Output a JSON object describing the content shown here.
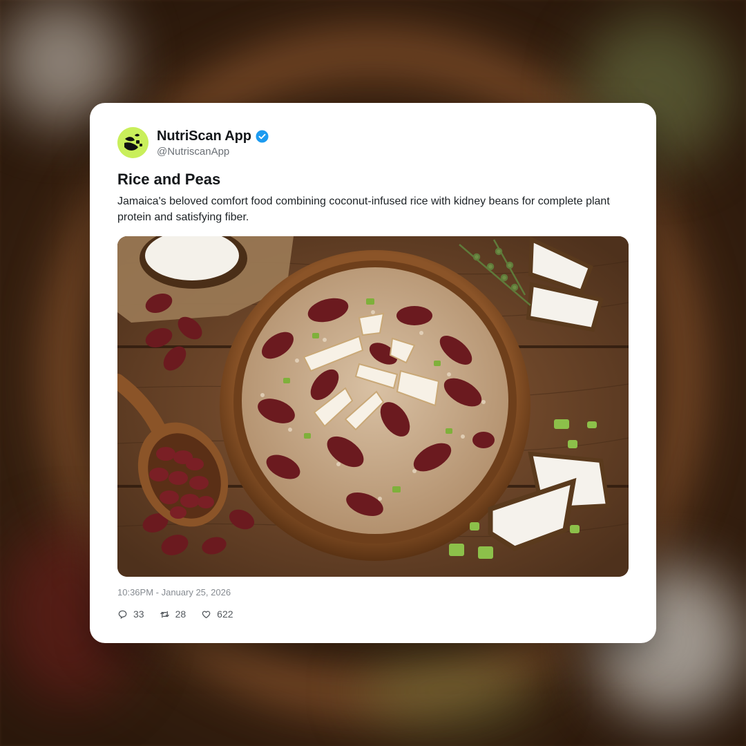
{
  "post": {
    "display_name": "NutriScan App",
    "handle": "@NutriscanApp",
    "verified_icon": "verified-check-icon",
    "title": "Rice and Peas",
    "description": "Jamaica's beloved comfort food combining coconut-infused rice with kidney beans for complete plant protein and satisfying fiber.",
    "timestamp": "10:36PM - January 25, 2026",
    "image_icon": "rice-and-peas-photo"
  },
  "stats": {
    "replies": "33",
    "reposts": "28",
    "likes": "622"
  },
  "colors": {
    "avatar_bg": "#c9ef5b",
    "verified_blue": "#1d9bf0",
    "card_bg": "#ffffff"
  }
}
